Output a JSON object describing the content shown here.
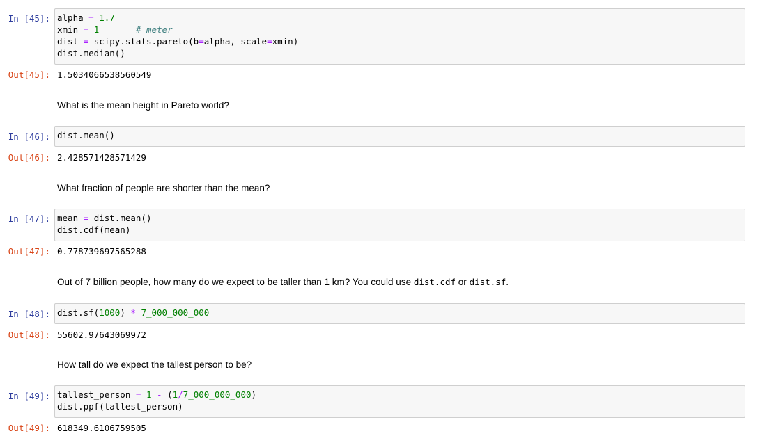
{
  "cells": {
    "c45": {
      "in_prompt": "In [45]:",
      "out_prompt": "Out[45]:",
      "code": {
        "l1_a": "alpha ",
        "l1_op": "=",
        "l1_num": " 1.7",
        "l2_a": "xmin ",
        "l2_op": "=",
        "l2_num": " 1",
        "l2_space": "       ",
        "l2_comment": "# meter",
        "l3_a": "dist ",
        "l3_op": "=",
        "l3_b": " scipy.stats.pareto(b",
        "l3_op2": "=",
        "l3_c": "alpha, scale",
        "l3_op3": "=",
        "l3_d": "xmin)",
        "l4": "dist.median()"
      },
      "output": "1.5034066538560549"
    },
    "md1": "What is the mean height in Pareto world?",
    "c46": {
      "in_prompt": "In [46]:",
      "out_prompt": "Out[46]:",
      "code": {
        "l1": "dist.mean()"
      },
      "output": "2.428571428571429"
    },
    "md2": "What fraction of people are shorter than the mean?",
    "c47": {
      "in_prompt": "In [47]:",
      "out_prompt": "Out[47]:",
      "code": {
        "l1_a": "mean ",
        "l1_op": "=",
        "l1_b": " dist.mean()",
        "l2": "dist.cdf(mean)"
      },
      "output": "0.778739697565288"
    },
    "md3": {
      "text1": "Out of 7 billion people, how many do we expect to be taller than 1 km? You could use ",
      "code1": "dist.cdf",
      "text2": " or ",
      "code2": "dist.sf",
      "text3": "."
    },
    "c48": {
      "in_prompt": "In [48]:",
      "out_prompt": "Out[48]:",
      "code": {
        "l1_a": "dist.sf(",
        "l1_num": "1000",
        "l1_b": ") ",
        "l1_op": "*",
        "l1_num2": " 7_000_000_000"
      },
      "output": "55602.97643069972"
    },
    "md4": "How tall do we expect the tallest person to be?",
    "c49": {
      "in_prompt": "In [49]:",
      "out_prompt": "Out[49]:",
      "code": {
        "l1_a": "tallest_person ",
        "l1_op": "=",
        "l1_num": " 1",
        "l1_sp": " ",
        "l1_op2": "-",
        "l1_b": " (",
        "l1_num2": "1",
        "l1_op3": "/",
        "l1_num3": "7_000_000_000",
        "l1_c": ")",
        "l2": "dist.ppf(tallest_person)"
      },
      "output": "618349.6106759505"
    }
  }
}
